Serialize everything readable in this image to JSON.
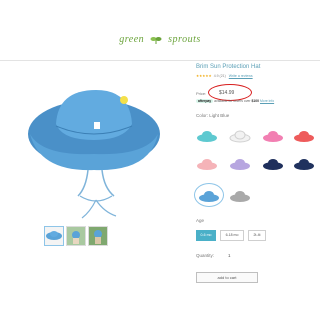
{
  "brand": {
    "word1": "green",
    "word2": "sprouts"
  },
  "product": {
    "title": "Brim Sun Protection Hat",
    "stars": "★★★★★",
    "rating_text": "4.9 (21)",
    "write_review": "Write a reviews",
    "price_label": "Price:",
    "price": "$14.99",
    "afterpay": {
      "brand": "afterpay",
      "text_prefix": "available for orders over",
      "threshold": "$100",
      "more_info": "More info"
    },
    "color_label": "Color: Light Blue",
    "colors": [
      {
        "name": "aqua",
        "hex": "#5ec9d0"
      },
      {
        "name": "white",
        "hex": "#f2f2f2"
      },
      {
        "name": "pink",
        "hex": "#f27fb2"
      },
      {
        "name": "coral",
        "hex": "#ee5b5b"
      },
      {
        "name": "light-pink",
        "hex": "#f5b3b8"
      },
      {
        "name": "lavender",
        "hex": "#b7a6e0"
      },
      {
        "name": "navy-dots",
        "hex": "#1f2f5c"
      },
      {
        "name": "navy",
        "hex": "#20325e"
      },
      {
        "name": "light-blue",
        "hex": "#5aa3d8"
      },
      {
        "name": "gray",
        "hex": "#a9a9a9"
      }
    ],
    "selected_color": "light-blue",
    "age_label": "Age",
    "ages": [
      "0-6 mo",
      "6-18 mo",
      "2t-4t"
    ],
    "selected_age": "0-6 mo",
    "quantity_label": "Quantity:",
    "quantity": "1",
    "add_to_cart": "add to cart"
  },
  "theme": {
    "accent": "#4ab0c8",
    "circle_highlight": "#d81e1e",
    "hat": "#5aa3d8"
  }
}
